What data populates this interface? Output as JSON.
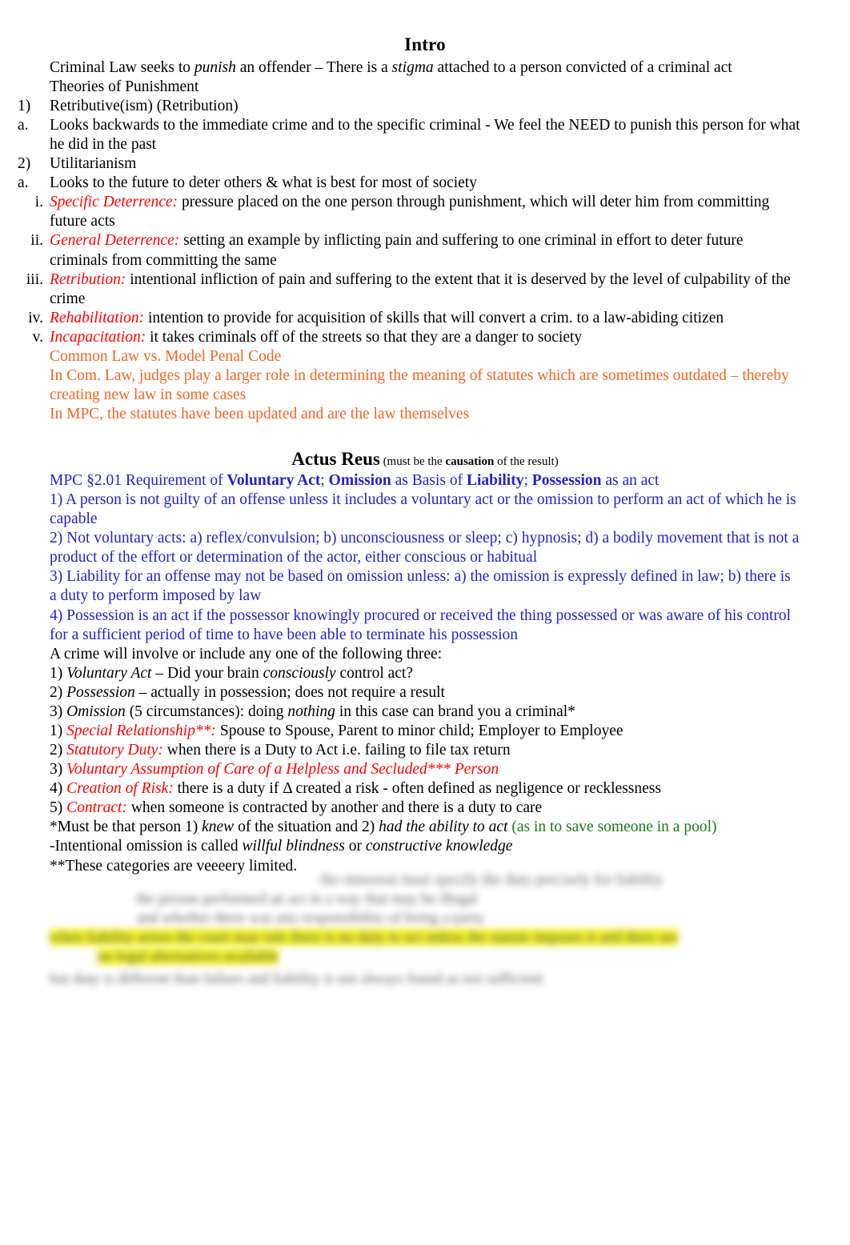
{
  "document": {
    "section1": {
      "heading": "Intro",
      "intro_line_pre": "Criminal Law seeks to ",
      "intro_punish": "punish",
      "intro_mid": " an offender – There is a ",
      "intro_stigma": "stigma",
      "intro_post": " attached to a person convicted of a criminal act",
      "theories_label": "Theories of Punishment",
      "items": [
        {
          "marker": "1)",
          "text": "Retributive(ism) (Retribution)",
          "sub": [
            {
              "marker": "a.",
              "text": "Looks backwards to the immediate crime and to the specific criminal - We feel the NEED to punish this person for what he did in the past"
            }
          ]
        },
        {
          "marker": "2)",
          "text": "Utilitarianism",
          "sub": [
            {
              "marker": "a.",
              "text": "Looks to the future to deter others & what is best for most of society",
              "sub": [
                {
                  "marker": "i.",
                  "label": "Specific Deterrence:",
                  "text": " pressure placed on the one person through punishment, which will deter him from committing future acts"
                },
                {
                  "marker": "ii.",
                  "label": "General Deterrence:",
                  "text": " setting an example by inflicting pain and suffering to one criminal in effort to deter future criminals from committing the same"
                },
                {
                  "marker": "iii.",
                  "label": "Retribution:",
                  "text": " intentional infliction of pain and suffering to the extent that it is deserved by the level of culpability of the crime"
                },
                {
                  "marker": "iv.",
                  "label": "Rehabilitation:",
                  "text": " intention to provide for acquisition of skills that will convert a crim. to a law-abiding citizen"
                },
                {
                  "marker": "v.",
                  "label": "Incapacitation:",
                  "text": " it takes criminals off of the streets so that they are a danger to society"
                }
              ]
            }
          ]
        }
      ],
      "common_law_heading": "Common Law vs. Model Penal Code",
      "common_law_body": "In Com. Law, judges play a larger role in determining the meaning of statutes which are sometimes outdated – thereby creating new law in some cases",
      "mpc_body": "In MPC, the statutes have been updated and are the law themselves"
    },
    "section2": {
      "heading": "Actus Reus",
      "heading_paren_pre": "(must be the ",
      "heading_paren_bold": "causation",
      "heading_paren_post": " of the result)",
      "mpc_title_parts": [
        {
          "text": "MPC §2.01 Requirement of ",
          "bold": false
        },
        {
          "text": "Voluntary Act",
          "bold": true
        },
        {
          "text": "; ",
          "bold": false
        },
        {
          "text": "Omission",
          "bold": true
        },
        {
          "text": " as Basis of ",
          "bold": false
        },
        {
          "text": "Liability",
          "bold": true
        },
        {
          "text": "; ",
          "bold": false
        },
        {
          "text": "Possession",
          "bold": true
        },
        {
          "text": " as an act",
          "bold": false
        }
      ],
      "mpc_clauses": [
        "1) A person is not guilty of an offense unless it includes a voluntary act or the omission to perform an act of which he is capable",
        "2) Not voluntary acts: a) reflex/convulsion; b) unconsciousness or sleep; c) hypnosis; d) a bodily movement that is not a product of the effort or determination of the actor, either conscious or habitual",
        "3) Liability for an offense may not be based on omission unless: a) the omission is expressly defined in law; b) there is a duty to perform imposed by law",
        "4) Possession is an act if the possessor knowingly procured or received the thing possessed or was aware of his control for a sufficient period of time to have been able to terminate his possession"
      ],
      "crime_intro": "A crime will involve or include any one of the following three:",
      "three": [
        {
          "marker": "1)",
          "italic_lead": "Voluntary Act",
          "rest_pre": " – Did your brain ",
          "rest_italic": "consciously",
          "rest_post": " control act?"
        },
        {
          "marker": "2)",
          "italic_lead": "Possession",
          "rest_pre": " – actually in possession; does not require a result",
          "rest_italic": "",
          "rest_post": ""
        },
        {
          "marker": "3)",
          "italic_lead": "Omission",
          "rest_pre": " (5 circumstances): doing ",
          "rest_italic": "nothing",
          "rest_post": " in this case can brand you a criminal*"
        }
      ],
      "omission_items": [
        {
          "marker": "1)",
          "label": "Special Relationship**:",
          "text": " Spouse to Spouse, Parent to minor child; Employer to Employee",
          "all_red": false
        },
        {
          "marker": "2)",
          "label": "Statutory Duty:",
          "text": " when there is a Duty to Act i.e. failing to file tax return",
          "all_red": false
        },
        {
          "marker": "3)",
          "label": "Voluntary Assumption of Care of a Helpless and Secluded*** Person",
          "text": "",
          "all_red": true
        },
        {
          "marker": "4)",
          "label": "Creation of Risk:",
          "text": " there is a duty if Δ created a risk - often defined as negligence or recklessness",
          "all_red": false
        },
        {
          "marker": "5)",
          "label": "Contract:",
          "text": " when someone is contracted by another and there is a duty to care",
          "all_red": false
        }
      ],
      "footnotes": {
        "star_pre": "*Must be that person 1) ",
        "star_i1": "knew",
        "star_mid": " of the situation and 2) ",
        "star_i2": "had the ability to act",
        "star_green": " (as in to save someone in a pool)",
        "dash_pre": "-Intentional omission is called ",
        "dash_i1": "willful blindness",
        "dash_mid": " or ",
        "dash_i2": "constructive knowledge",
        "double_star": "**These categories are veeeery limited."
      }
    },
    "redacted": {
      "note": "blurred illegible text",
      "lines": [
        "the omission must specify the duty precisely for liability",
        "the person performed an act in a way that may be illegal",
        "and whether there was any responsibility of being a party",
        "when liability arises the court may rule there is no duty to act unless the statute imposes it and there are",
        "no legal alternatives available",
        "but duty is different than failure and liability is not always found as not sufficient"
      ]
    },
    "colors": {
      "red": "#ff0000",
      "blue": "#2222cc",
      "orange": "#f26522",
      "green": "#1a7a1a",
      "highlight": "#f2f20a"
    }
  }
}
